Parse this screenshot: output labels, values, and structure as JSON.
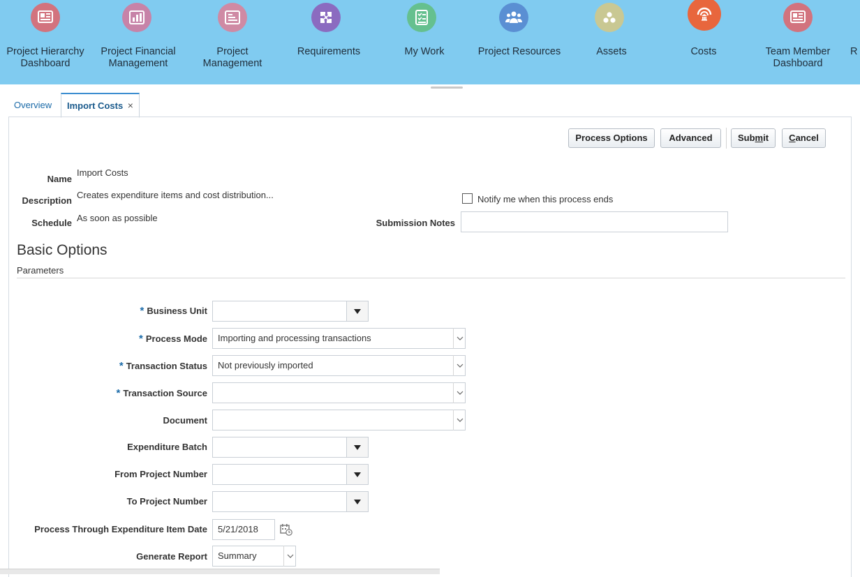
{
  "springboard": {
    "items": [
      {
        "label": "Project Hierarchy Dashboard",
        "icon": "dashboard-icon",
        "color": "#d2737e"
      },
      {
        "label": "Project Financial Management",
        "icon": "chart-icon",
        "color": "#c783a8"
      },
      {
        "label": "Project Management",
        "icon": "gantt-icon",
        "color": "#cf8aa4"
      },
      {
        "label": "Requirements",
        "icon": "puzzle-icon",
        "color": "#8b6bc0"
      },
      {
        "label": "My Work",
        "icon": "checklist-icon",
        "color": "#65c08f"
      },
      {
        "label": "Project Resources",
        "icon": "people-icon",
        "color": "#5a8fd3"
      },
      {
        "label": "Assets",
        "icon": "dots-icon",
        "color": "#c9c893"
      },
      {
        "label": "Costs",
        "icon": "bank-icon",
        "color": "#e8663d"
      },
      {
        "label": "Team Member Dashboard",
        "icon": "dashboard-icon",
        "color": "#d2737e"
      },
      {
        "label": "R",
        "icon": "",
        "color": ""
      }
    ]
  },
  "tabs": {
    "overview": "Overview",
    "import": "Import Costs",
    "close": "×"
  },
  "toolbar": {
    "process_options": "Process Options",
    "advanced": "Advanced",
    "submit_pre": "Sub",
    "submit_mnemonic": "m",
    "submit_post": "it",
    "cancel_mnemonic": "C",
    "cancel_post": "ancel"
  },
  "header": {
    "name_label": "Name",
    "name_value": "Import Costs",
    "description_label": "Description",
    "description_value": "Creates expenditure items and cost distribution...",
    "schedule_label": "Schedule",
    "schedule_value": "As soon as possible",
    "notify_label": "Notify me when this process ends",
    "submission_notes_label": "Submission Notes",
    "submission_notes_value": ""
  },
  "section": {
    "title": "Basic Options",
    "subtitle": "Parameters"
  },
  "params": {
    "required_mark": "*",
    "business_unit": {
      "label": "Business Unit",
      "value": ""
    },
    "process_mode": {
      "label": "Process Mode",
      "value": "Importing and processing transactions"
    },
    "transaction_status": {
      "label": "Transaction Status",
      "value": "Not previously imported"
    },
    "transaction_source": {
      "label": "Transaction Source",
      "value": ""
    },
    "document": {
      "label": "Document",
      "value": ""
    },
    "expenditure_batch": {
      "label": "Expenditure Batch",
      "value": ""
    },
    "from_project": {
      "label": "From Project Number",
      "value": ""
    },
    "to_project": {
      "label": "To Project Number",
      "value": ""
    },
    "through_date": {
      "label": "Process Through Expenditure Item Date",
      "value": "5/21/2018"
    },
    "generate_report": {
      "label": "Generate Report",
      "value": "Summary"
    }
  }
}
